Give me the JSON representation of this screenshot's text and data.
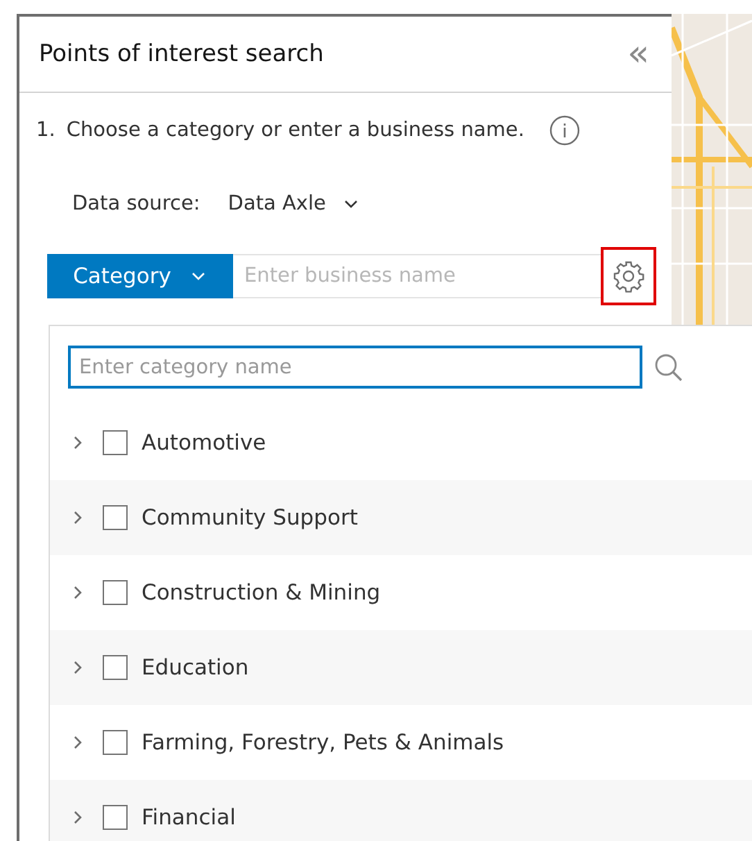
{
  "panel": {
    "title": "Points of interest search",
    "collapse_icon": "«"
  },
  "step": {
    "number": "1.",
    "text": "Choose a category or enter a business name."
  },
  "data_source": {
    "label": "Data source:",
    "value": "Data Axle"
  },
  "search_mode": {
    "button": "Category",
    "placeholder": "Enter business name",
    "settings_highlighted": true
  },
  "category_dropdown": {
    "placeholder": "Enter category name",
    "focused": true,
    "items": [
      {
        "label": "Automotive",
        "checked": false,
        "expanded": false
      },
      {
        "label": "Community Support",
        "checked": false,
        "expanded": false
      },
      {
        "label": "Construction & Mining",
        "checked": false,
        "expanded": false
      },
      {
        "label": "Education",
        "checked": false,
        "expanded": false
      },
      {
        "label": "Farming, Forestry, Pets & Animals",
        "checked": false,
        "expanded": false
      },
      {
        "label": "Financial",
        "checked": false,
        "expanded": false
      }
    ]
  }
}
